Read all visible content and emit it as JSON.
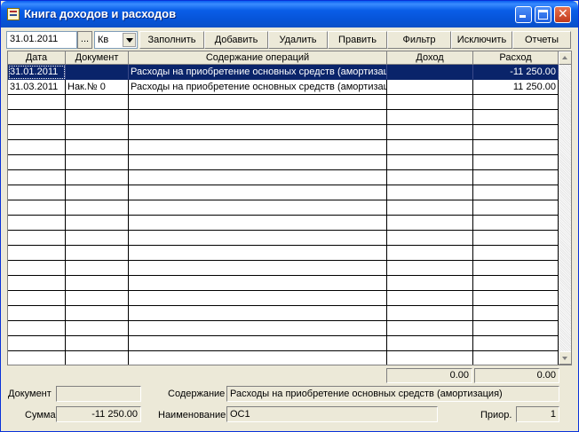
{
  "window": {
    "title": "Книга доходов и расходов"
  },
  "toolbar": {
    "date_value": "31.01.2011",
    "dots_label": "...",
    "period_value": "Кв",
    "buttons": {
      "fill": "Заполнить",
      "add": "Добавить",
      "delete": "Удалить",
      "edit": "Править",
      "filter": "Фильтр",
      "exclude": "Исключить",
      "reports": "Отчеты"
    }
  },
  "table": {
    "columns": {
      "date": "Дата",
      "document": "Документ",
      "content": "Содержание операций",
      "income": "Доход",
      "expense": "Расход"
    },
    "rows": [
      {
        "date": "31.01.2011",
        "document": "",
        "content": "Расходы на приобретение основных средств (амортизац",
        "income": "",
        "expense": "-11 250.00",
        "selected": true
      },
      {
        "date": "31.03.2011",
        "document": "Нак.№ 0",
        "content": "Расходы на приобретение основных средств (амортизац",
        "income": "",
        "expense": "11 250.00",
        "selected": false
      }
    ],
    "total_income": "0.00",
    "total_expense": "0.00"
  },
  "details": {
    "document_label": "Документ",
    "document_value": "",
    "amount_label": "Сумма",
    "amount_value": "-11 250.00",
    "content_label": "Содержание",
    "content_value": "Расходы на приобретение основных средств (амортизация)",
    "name_label": "Наименование",
    "name_value": "ОС1",
    "priority_label": "Приор.",
    "priority_value": "1"
  }
}
